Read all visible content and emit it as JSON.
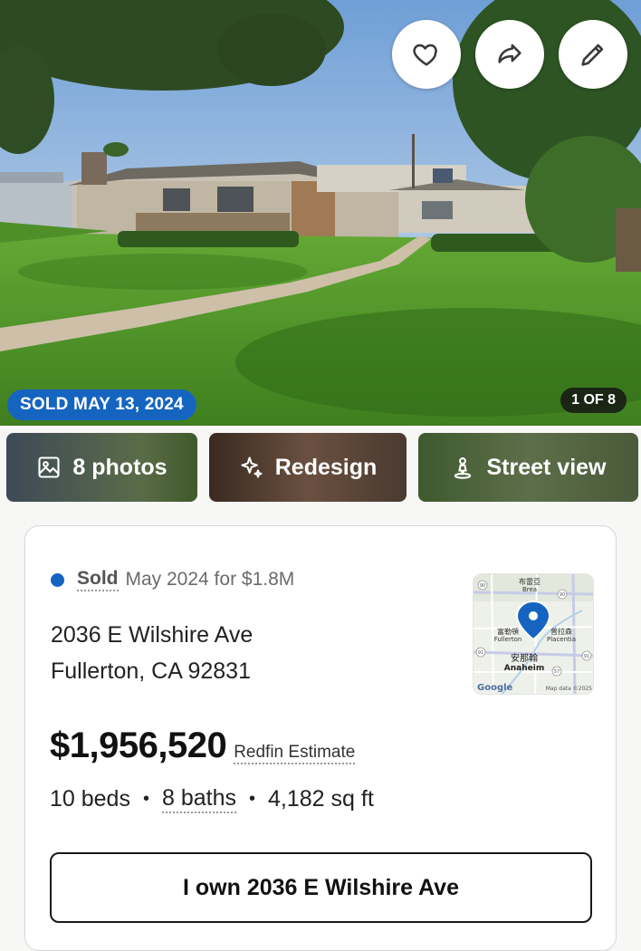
{
  "hero": {
    "sold_badge": "SOLD MAY 13, 2024",
    "photo_counter": "1 OF 8",
    "actions": {
      "favorite_icon": "heart-icon",
      "share_icon": "share-arrow-icon",
      "edit_icon": "pencil-icon"
    }
  },
  "media": {
    "photos_label": "8 photos",
    "redesign_label": "Redesign",
    "street_view_label": "Street view"
  },
  "listing": {
    "status_word": "Sold",
    "status_detail": "May 2024 for $1.8M",
    "address_line1": "2036 E Wilshire Ave",
    "address_line2": "Fullerton, CA 92831",
    "price": "$1,956,520",
    "estimate_label": "Redfin Estimate",
    "beds": "10 beds",
    "baths": "8 baths",
    "sqft": "4,182 sq ft",
    "fact_separator": "•",
    "own_button": "I own 2036 E Wilshire Ave"
  },
  "map": {
    "labels": [
      "布雷亞",
      "Brea",
      "富勒頓",
      "Fullerton",
      "普拉森",
      "Placentia",
      "安那翰",
      "Anaheim"
    ],
    "google": "Google",
    "attribution": "Map data ©2025",
    "routes": [
      "90",
      "90",
      "91",
      "57",
      "91"
    ]
  },
  "colors": {
    "accent": "#1565c0",
    "text": "#1a1a1a",
    "muted": "#6b6b6b"
  }
}
